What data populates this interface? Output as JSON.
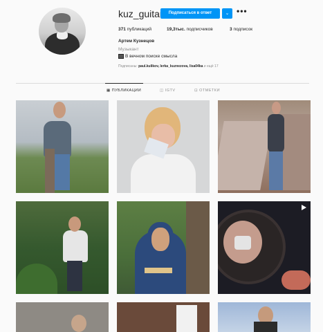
{
  "profile": {
    "username": "kuz_guitar",
    "reply_button": "Подписаться в ответ",
    "more": "•••",
    "dropdown": "⌄",
    "stats": {
      "posts_value": "371",
      "posts_label": "публикаций",
      "followers_value": "19,3тыс.",
      "followers_label": "подписчиков",
      "following_value": "3",
      "following_label": "подписок"
    },
    "full_name": "Артем Кузнецов",
    "category": "Музыкант",
    "bio": "В вечном поиске смысла",
    "followed_prefix": "Подписаны:",
    "followed_names": "paul.kulikov, lerka_kuznezova, lisa04ka",
    "followed_suffix": "и ещё 17"
  },
  "tabs": [
    {
      "label": "ПУБЛИКАЦИИ",
      "icon": "grid-icon"
    },
    {
      "label": "IGTV",
      "icon": "igtv-icon"
    },
    {
      "label": "ОТМЕТКИ",
      "icon": "tagged-icon"
    }
  ],
  "colors": {
    "accent": "#0095f6",
    "background": "#fafafa",
    "divider": "#dbdbdb"
  }
}
